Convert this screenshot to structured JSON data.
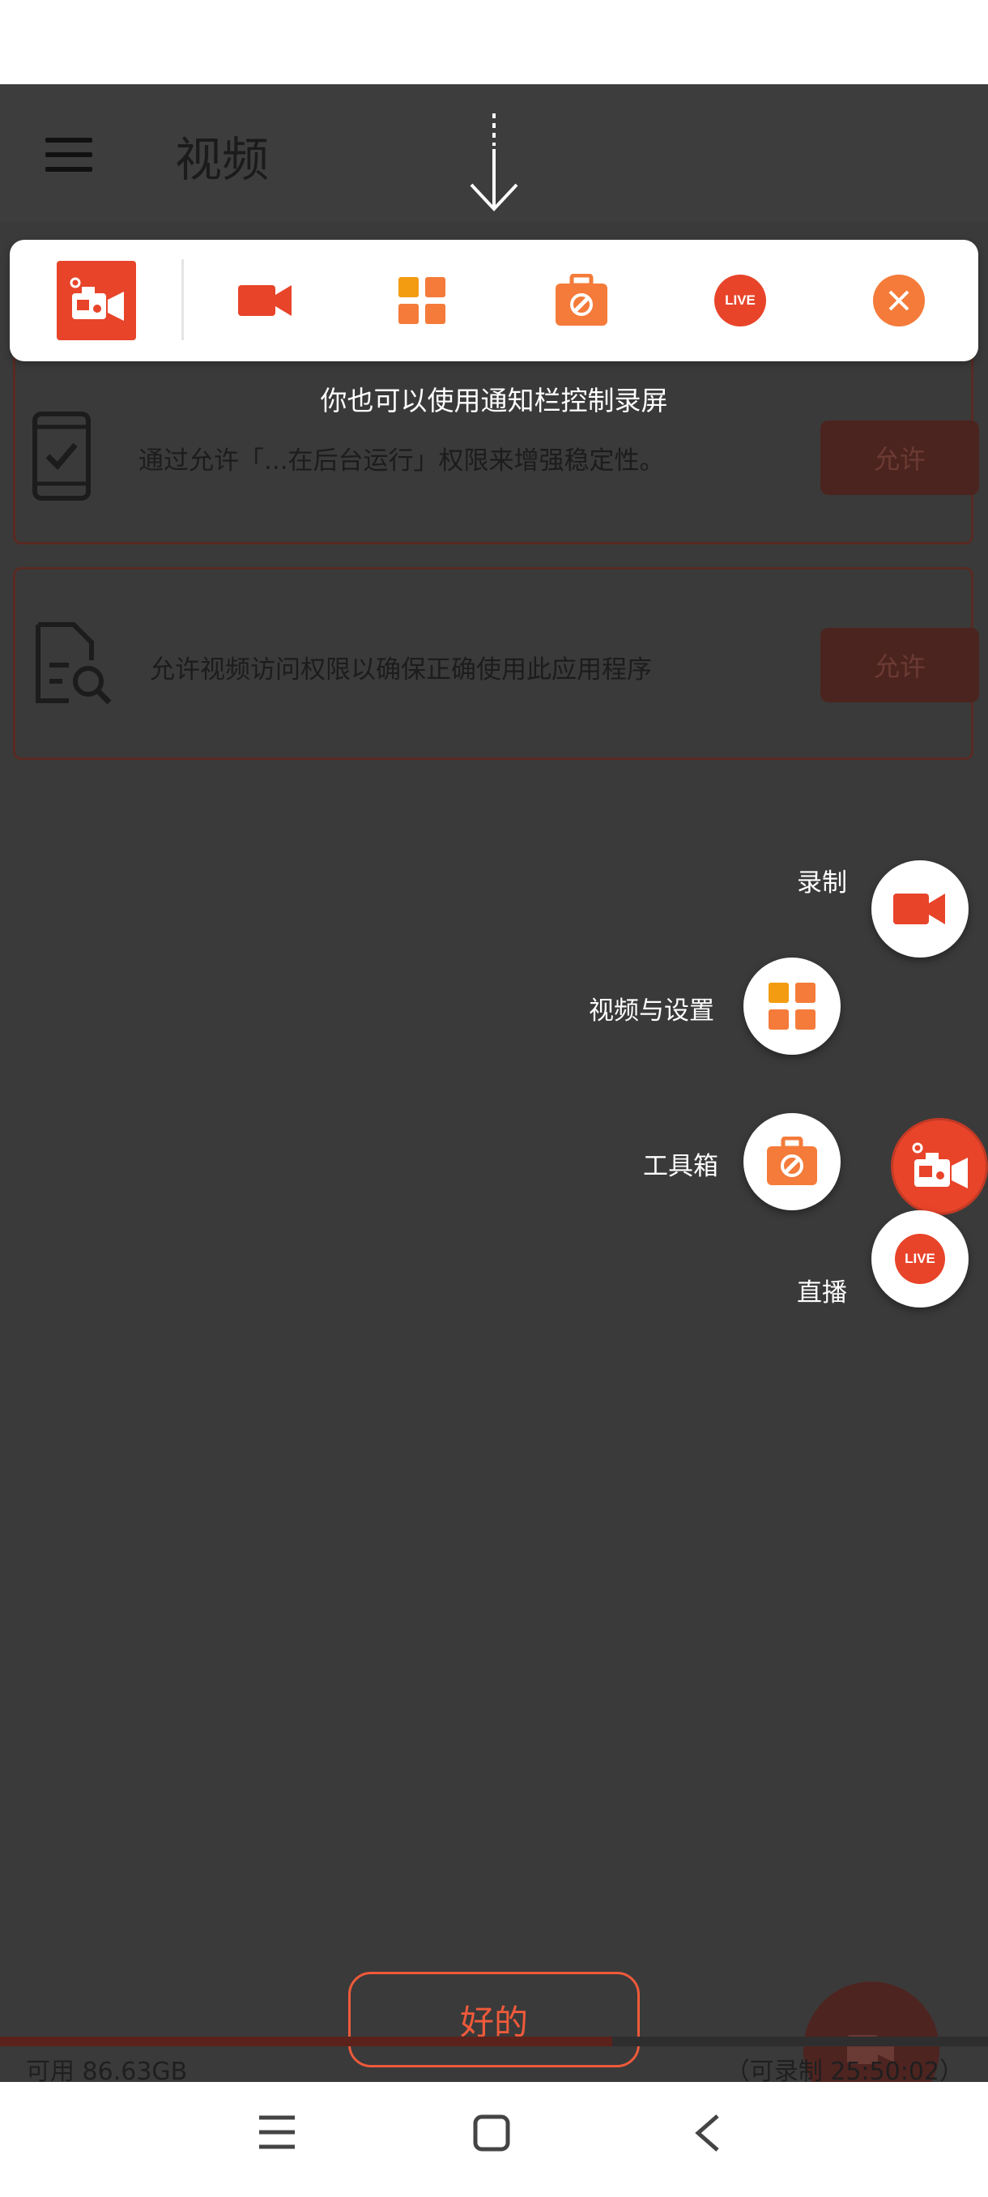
{
  "toolbar": {
    "title": "视频",
    "menu_icon": "hamburger-menu-icon"
  },
  "permissions": [
    {
      "text": "通过允许「...在后台运行」权限来增强稳定性。",
      "button": "允许",
      "icon": "phone-check-icon"
    },
    {
      "text": "允许视频访问权限以确保正确使用此应用程序",
      "button": "允许",
      "icon": "document-search-icon"
    }
  ],
  "quickbar": {
    "items": [
      "app-logo-icon",
      "record-camera-icon",
      "grid-apps-icon",
      "toolbox-icon",
      "live-icon",
      "close-icon"
    ]
  },
  "tip": "你也可以使用通知栏控制录屏",
  "radial_menu": {
    "record": "录制",
    "videos_settings": "视频与设置",
    "toolbox": "工具箱",
    "live": "直播",
    "live_badge": "LIVE"
  },
  "ok_button": "好的",
  "storage": {
    "free": "可用 86.63GB",
    "remaining": "（可录制 25:50:02）",
    "used_fraction": 0.62
  },
  "colors": {
    "accent": "#ef5a3a",
    "red": "#e8442a",
    "orange": "#f39c12"
  },
  "navbar": {
    "items": [
      "recents-icon",
      "home-icon",
      "back-icon"
    ]
  }
}
